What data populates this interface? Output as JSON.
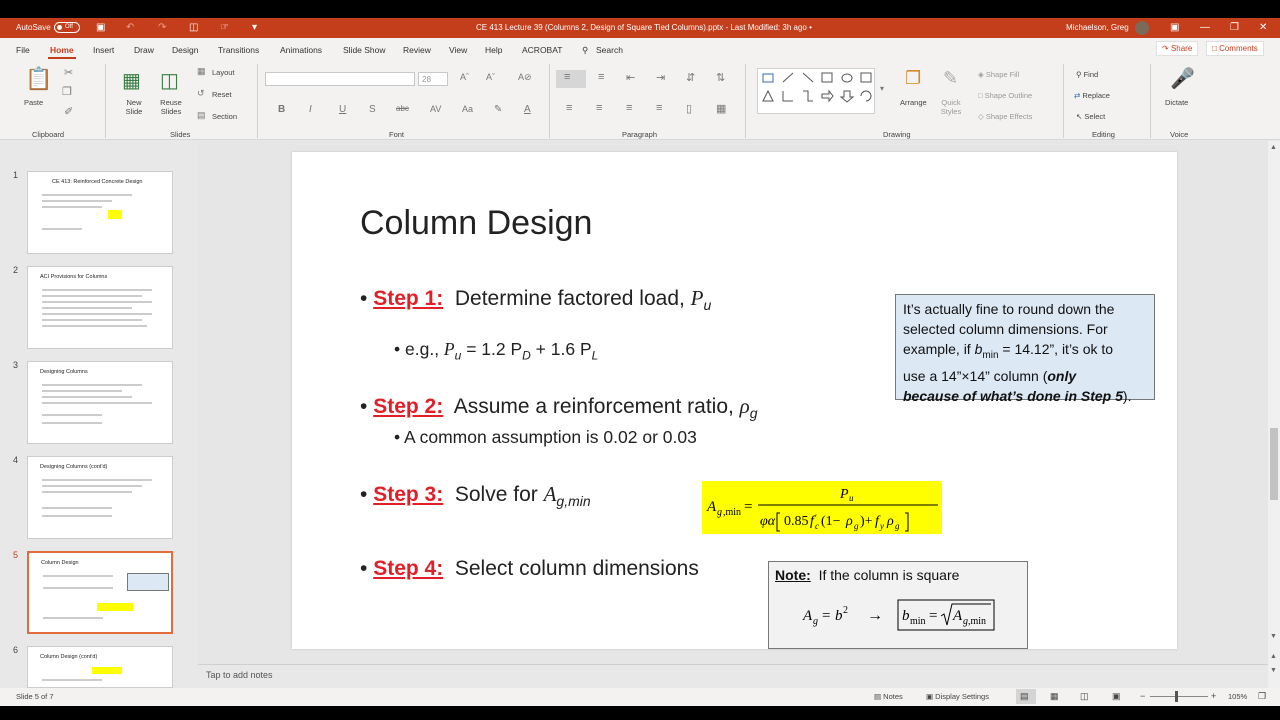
{
  "titlebar": {
    "autosave_label": "AutoSave",
    "autosave_state": "Off",
    "document_title": "CE 413 Lecture 39 (Columns 2, Design of Square Tied Columns).pptx  -  Last Modified: 3h ago  •",
    "user_name": "Michaelson, Greg"
  },
  "menu": {
    "items": [
      "File",
      "Home",
      "Insert",
      "Draw",
      "Design",
      "Transitions",
      "Animations",
      "Slide Show",
      "Review",
      "View",
      "Help",
      "ACROBAT"
    ],
    "search_label": "Search",
    "share_label": "Share",
    "comments_label": "Comments"
  },
  "ribbon": {
    "clipboard": {
      "paste": "Paste",
      "group": "Clipboard"
    },
    "slides": {
      "new_slide": "New Slide",
      "reuse": "Reuse Slides",
      "layout": "Layout",
      "reset": "Reset",
      "section": "Section",
      "group": "Slides"
    },
    "font": {
      "size": "28",
      "group": "Font",
      "bold": "B",
      "italic": "I",
      "underline": "U",
      "strike": "S",
      "shadow": "abc"
    },
    "paragraph": {
      "group": "Paragraph"
    },
    "drawing": {
      "arrange": "Arrange",
      "quick_styles": "Quick Styles",
      "shape_fill": "Shape Fill",
      "shape_outline": "Shape Outline",
      "shape_effects": "Shape Effects",
      "group": "Drawing"
    },
    "editing": {
      "find": "Find",
      "replace": "Replace",
      "select": "Select",
      "group": "Editing"
    },
    "voice": {
      "dictate": "Dictate",
      "group": "Voice"
    }
  },
  "slides_panel": [
    {
      "number": "1",
      "title": "CE 413:  Reinforced Concrete Design"
    },
    {
      "number": "2",
      "title": "ACI Provisions for Columns"
    },
    {
      "number": "3",
      "title": "Designing Columns"
    },
    {
      "number": "4",
      "title": "Designing Columns (cont'd)"
    },
    {
      "number": "5",
      "title": "Column Design"
    },
    {
      "number": "6",
      "title": "Column Design (cont'd)"
    }
  ],
  "slide": {
    "title": "Column Design",
    "step1_label": "Step 1:",
    "step1_text": "Determine factored load, ",
    "step1_var": "P",
    "step1_sub": "u",
    "step1_example_prefix": "e.g., ",
    "step1_example": "= 1.2 P",
    "step1_example_d": "D",
    "step1_example_mid": " + 1.6 P",
    "step1_example_l": "L",
    "step2_label": "Step 2:",
    "step2_text": "Assume a reinforcement ratio, ",
    "step2_var": "ρ",
    "step2_sub": "g",
    "step2_detail": "A common assumption is 0.02 or 0.03",
    "step3_label": "Step 3:",
    "step3_text": "Solve for ",
    "step3_var": "A",
    "step3_sub": "g,min",
    "step4_label": "Step 4:",
    "step4_text": "Select column dimensions",
    "callout": {
      "line1": "It’s actually fine to round down the",
      "line2": "selected column dimensions.  For",
      "line3a": "example, if ",
      "line3b": "b",
      "line3c": "min",
      "line3d": " = 14.12”, it’s ok to",
      "line4a": "use a 14”×14” column (",
      "line4b": "only",
      "line5a": "because of what’s done in Step 5",
      "line5b": ")."
    },
    "note_label": "Note:",
    "note_text": "If the column is square"
  },
  "notes_placeholder": "Tap to add notes",
  "status": {
    "slide_count": "Slide 5 of 7",
    "notes_button": "Notes",
    "display_settings": "Display Settings",
    "zoom": "105%"
  }
}
